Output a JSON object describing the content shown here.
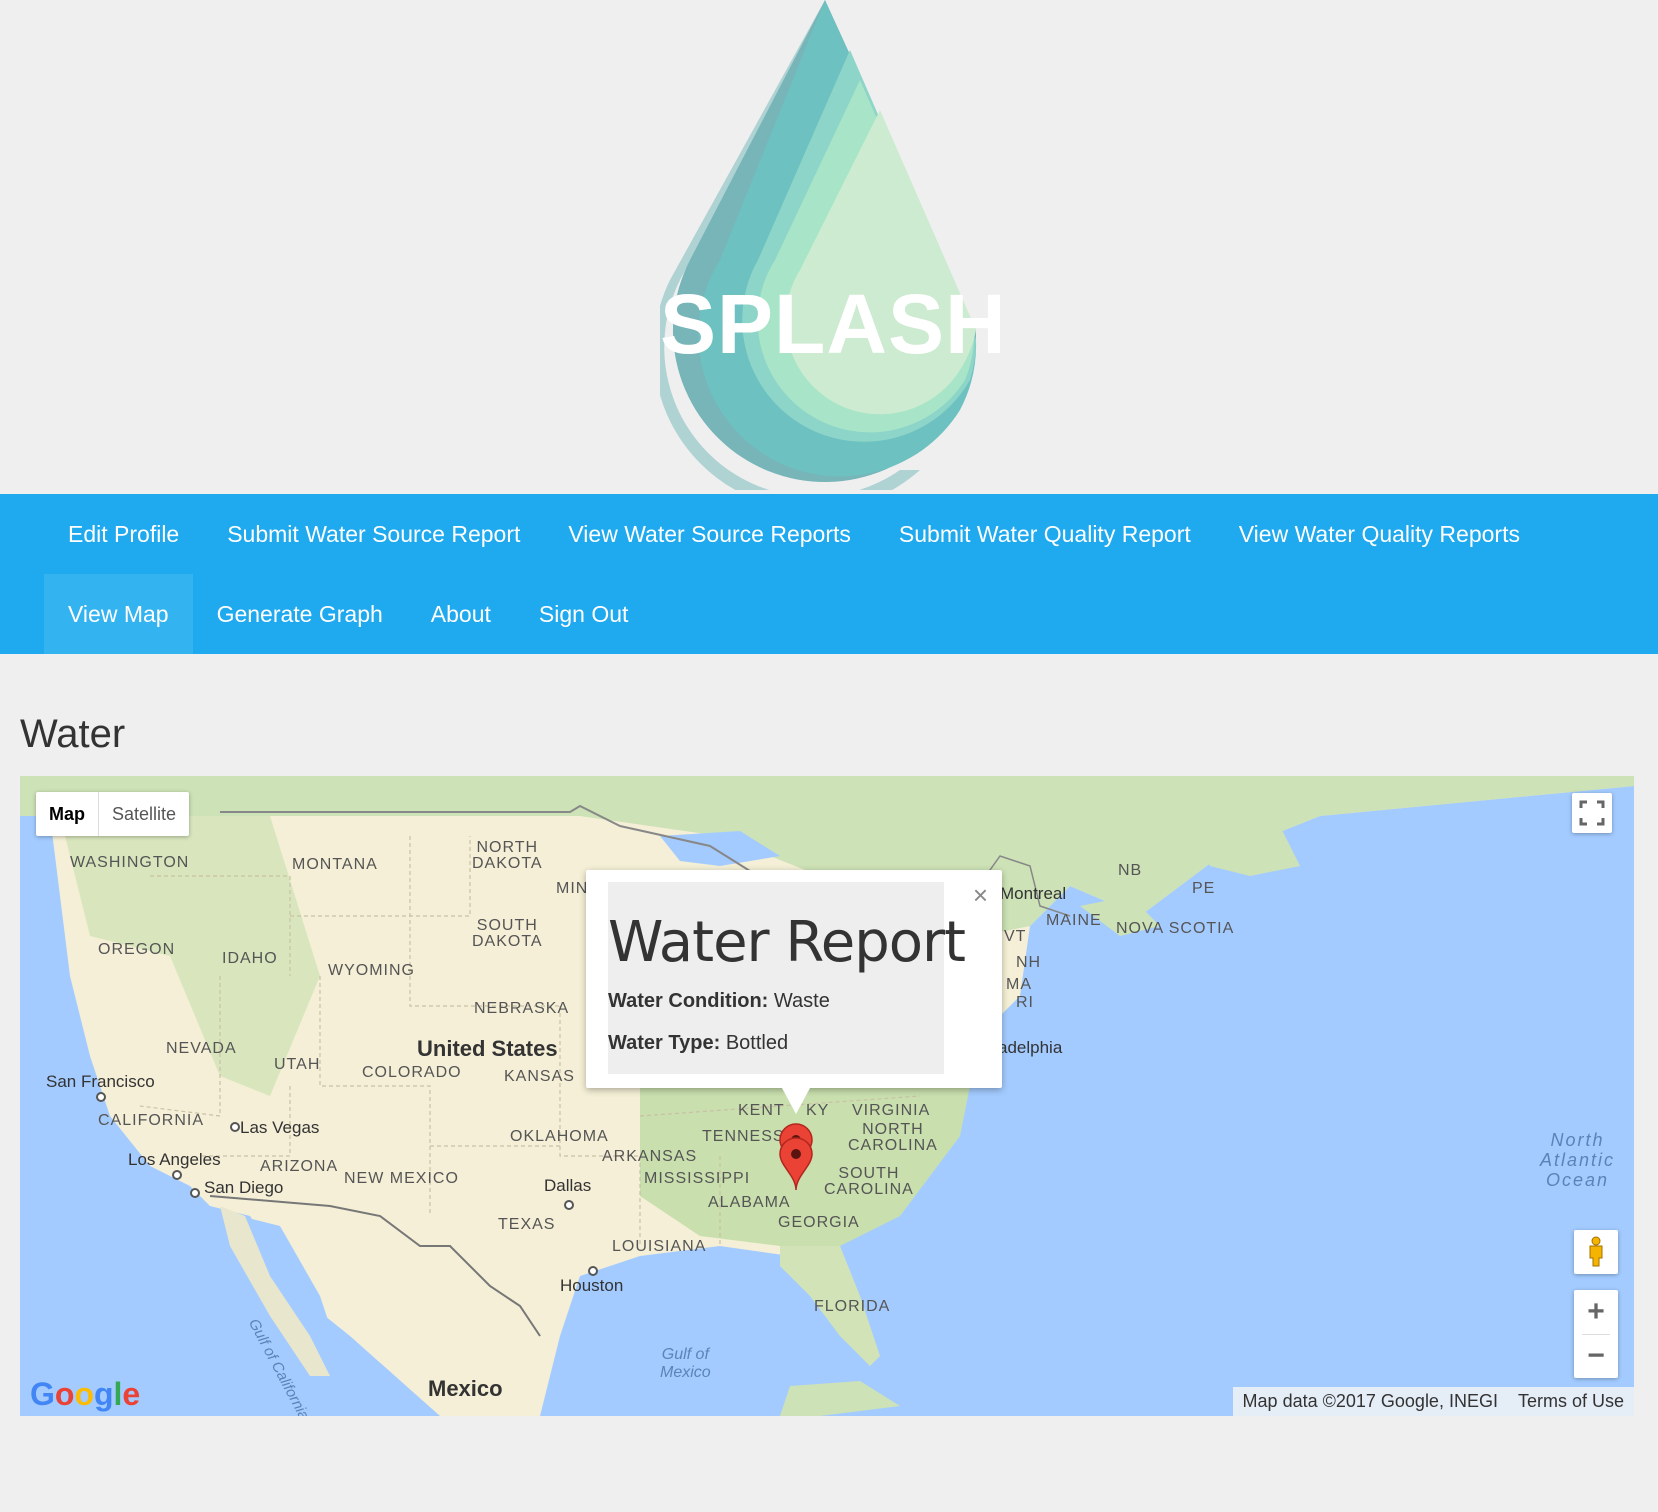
{
  "logo": {
    "text": "SPLASH"
  },
  "nav": {
    "row1": [
      "Edit Profile",
      "Submit Water Source Report",
      "View Water Source Reports",
      "Submit Water Quality Report",
      "View Water Quality Reports"
    ],
    "row2": [
      "View Map",
      "Generate Graph",
      "About",
      "Sign Out"
    ],
    "active": "View Map",
    "color": "#1fa9ef"
  },
  "page": {
    "title": "Water"
  },
  "map": {
    "type_buttons": [
      "Map",
      "Satellite"
    ],
    "selected_type": "Map",
    "zoom_in": "+",
    "zoom_out": "−",
    "google": "Google",
    "attribution": "Map data ©2017 Google, INEGI",
    "terms": "Terms of Use",
    "labels": {
      "washington": "WASHINGTON",
      "montana": "MONTANA",
      "north_dakota": "NORTH\nDAKOTA",
      "min": "MIN",
      "south_dakota": "SOUTH\nDAKOTA",
      "oregon": "OREGON",
      "idaho": "IDAHO",
      "wyoming": "WYOMING",
      "nebraska": "NEBRASKA",
      "nevada": "NEVADA",
      "utah": "UTAH",
      "united_states": "United States",
      "colorado": "COLORADO",
      "kansas": "KANSAS",
      "san_francisco": "San Francisco",
      "california": "CALIFORNIA",
      "las_vegas": "Las Vegas",
      "oklahoma": "OKLAHOMA",
      "los_angeles": "Los Angeles",
      "arizona": "ARIZONA",
      "san_diego": "San Diego",
      "new_mexico": "NEW MEXICO",
      "dallas": "Dallas",
      "arkansas": "ARKANSAS",
      "texas": "TEXAS",
      "mississippi": "MISSISSIPPI",
      "alabama": "ALABAMA",
      "georgia": "GEORGIA",
      "louisiana": "LOUISIANA",
      "houston": "Houston",
      "florida": "FLORIDA",
      "gulf_mexico": "Gulf of\nMexico",
      "gulf_california": "Gulf of California",
      "mexico": "Mexico",
      "kentucky": "KENT",
      "ky": "KY",
      "tennessee": "TENNESS",
      "virginia": "VIRGINIA",
      "north_carolina": "NORTH\nCAROLINA",
      "south_carolina": "SOUTH\nCAROLINA",
      "montreal": "Montreal",
      "maine": "MAINE",
      "nb": "NB",
      "pe": "PE",
      "nova_scotia": "NOVA SCOTIA",
      "vt": "VT",
      "nh": "NH",
      "ma": "MA",
      "ri": "RI",
      "philadelphia": "adelphia",
      "north_atlantic": "North\nAtlantic\nOcean"
    }
  },
  "info_window": {
    "title": "Water Report",
    "condition_label": "Water Condition:",
    "condition_value": "Waste",
    "type_label": "Water Type:",
    "type_value": "Bottled",
    "close": "×"
  }
}
